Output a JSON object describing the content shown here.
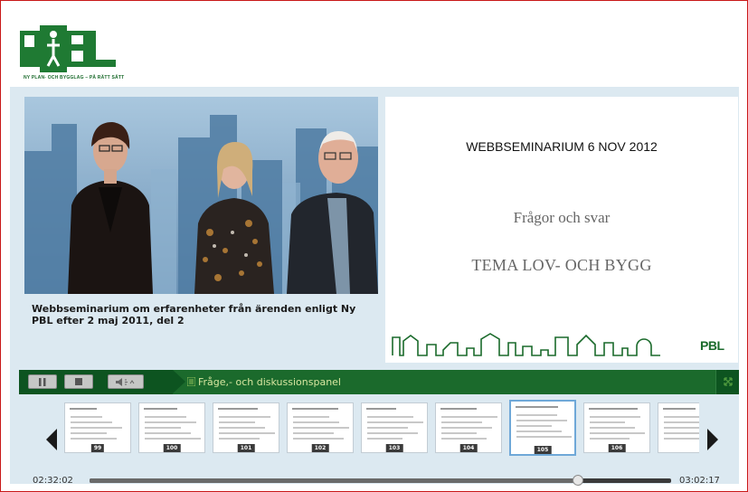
{
  "header": {
    "logo_text": "PBL",
    "logo_tagline": "NY PLAN- OCH BYGGLAG – PÅ RÄTT SÄTT"
  },
  "video": {
    "caption": "Webbseminarium om erfarenheter från ärenden enligt Ny PBL efter 2 maj 2011, del 2"
  },
  "slide": {
    "heading": "WEBBSEMINARIUM 6 NOV 2012",
    "subtitle": "Frågor och svar",
    "theme": "TEMA LOV- OCH BYGG",
    "footer_logo": "PBL"
  },
  "controls": {
    "play_icon": "pause-icon",
    "stop_icon": "stop-icon",
    "volume_icon": "volume-icon",
    "panel_label": "Fråge,- och diskussionspanel",
    "fullscreen_icon": "fullscreen-icon"
  },
  "thumbnails": {
    "items": [
      {
        "number": "99"
      },
      {
        "number": "100"
      },
      {
        "number": "101"
      },
      {
        "number": "102"
      },
      {
        "number": "103"
      },
      {
        "number": "104"
      },
      {
        "number": "105"
      },
      {
        "number": "106"
      },
      {
        "number": ""
      }
    ],
    "active_index": 6
  },
  "timeline": {
    "current": "02:32:02",
    "total": "03:02:17",
    "progress": 0.84
  },
  "colors": {
    "brand_green": "#1b6a2c",
    "dark_green": "#0d5420",
    "frame_red": "#c91818",
    "panel_blue": "#dce9f1"
  }
}
